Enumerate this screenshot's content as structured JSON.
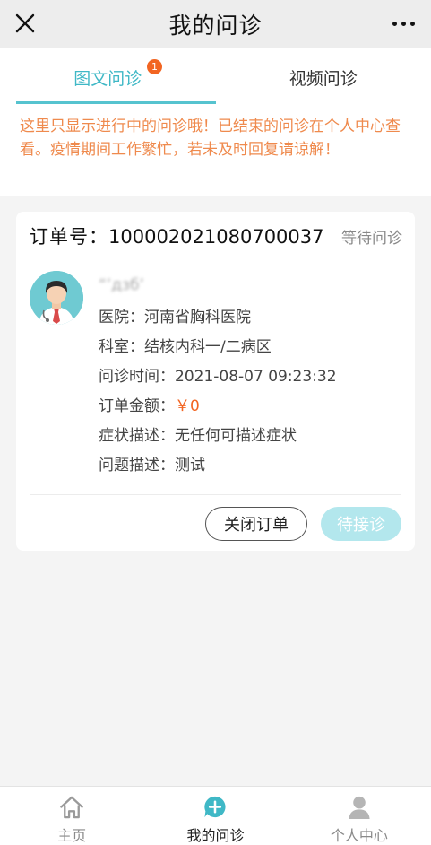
{
  "titlebar": {
    "title": "我的问诊",
    "close_icon": "close-icon",
    "more_icon": "more-icon"
  },
  "tabs": [
    {
      "label": "图文问诊",
      "badge": "1",
      "active": true
    },
    {
      "label": "视频问诊",
      "active": false
    }
  ],
  "notice": "这里只显示进行中的问诊哦！已结束的问诊在个人中心查看。疫情期间工作繁忙，若未及时回复请谅解！",
  "order": {
    "label": "订单号：",
    "number": "100002021080700037",
    "status": "等待问诊",
    "patient_name": "“’дзб’",
    "fields": [
      {
        "key": "医院：",
        "value": "河南省胸科医院"
      },
      {
        "key": "科室：",
        "value": "结核内科一/二病区"
      },
      {
        "key": "问诊时间：",
        "value": "2021-08-07 09:23:32"
      },
      {
        "key": "订单金额：",
        "value": "￥0"
      },
      {
        "key": "症状描述：",
        "value": "无任何可描述症状"
      },
      {
        "key": "问题描述：",
        "value": "测试"
      }
    ],
    "close_button": "关闭订单",
    "wait_button": "待接诊"
  },
  "bottom_nav": [
    {
      "label": "主页",
      "icon": "home-icon",
      "active": false
    },
    {
      "label": "我的问诊",
      "icon": "add-chat-icon",
      "active": true
    },
    {
      "label": "个人中心",
      "icon": "user-icon",
      "active": false
    }
  ],
  "colors": {
    "accent": "#3fb8c6",
    "notice": "#ef8a4d",
    "price": "#f26522",
    "wait_button": "#b3e7ed"
  }
}
